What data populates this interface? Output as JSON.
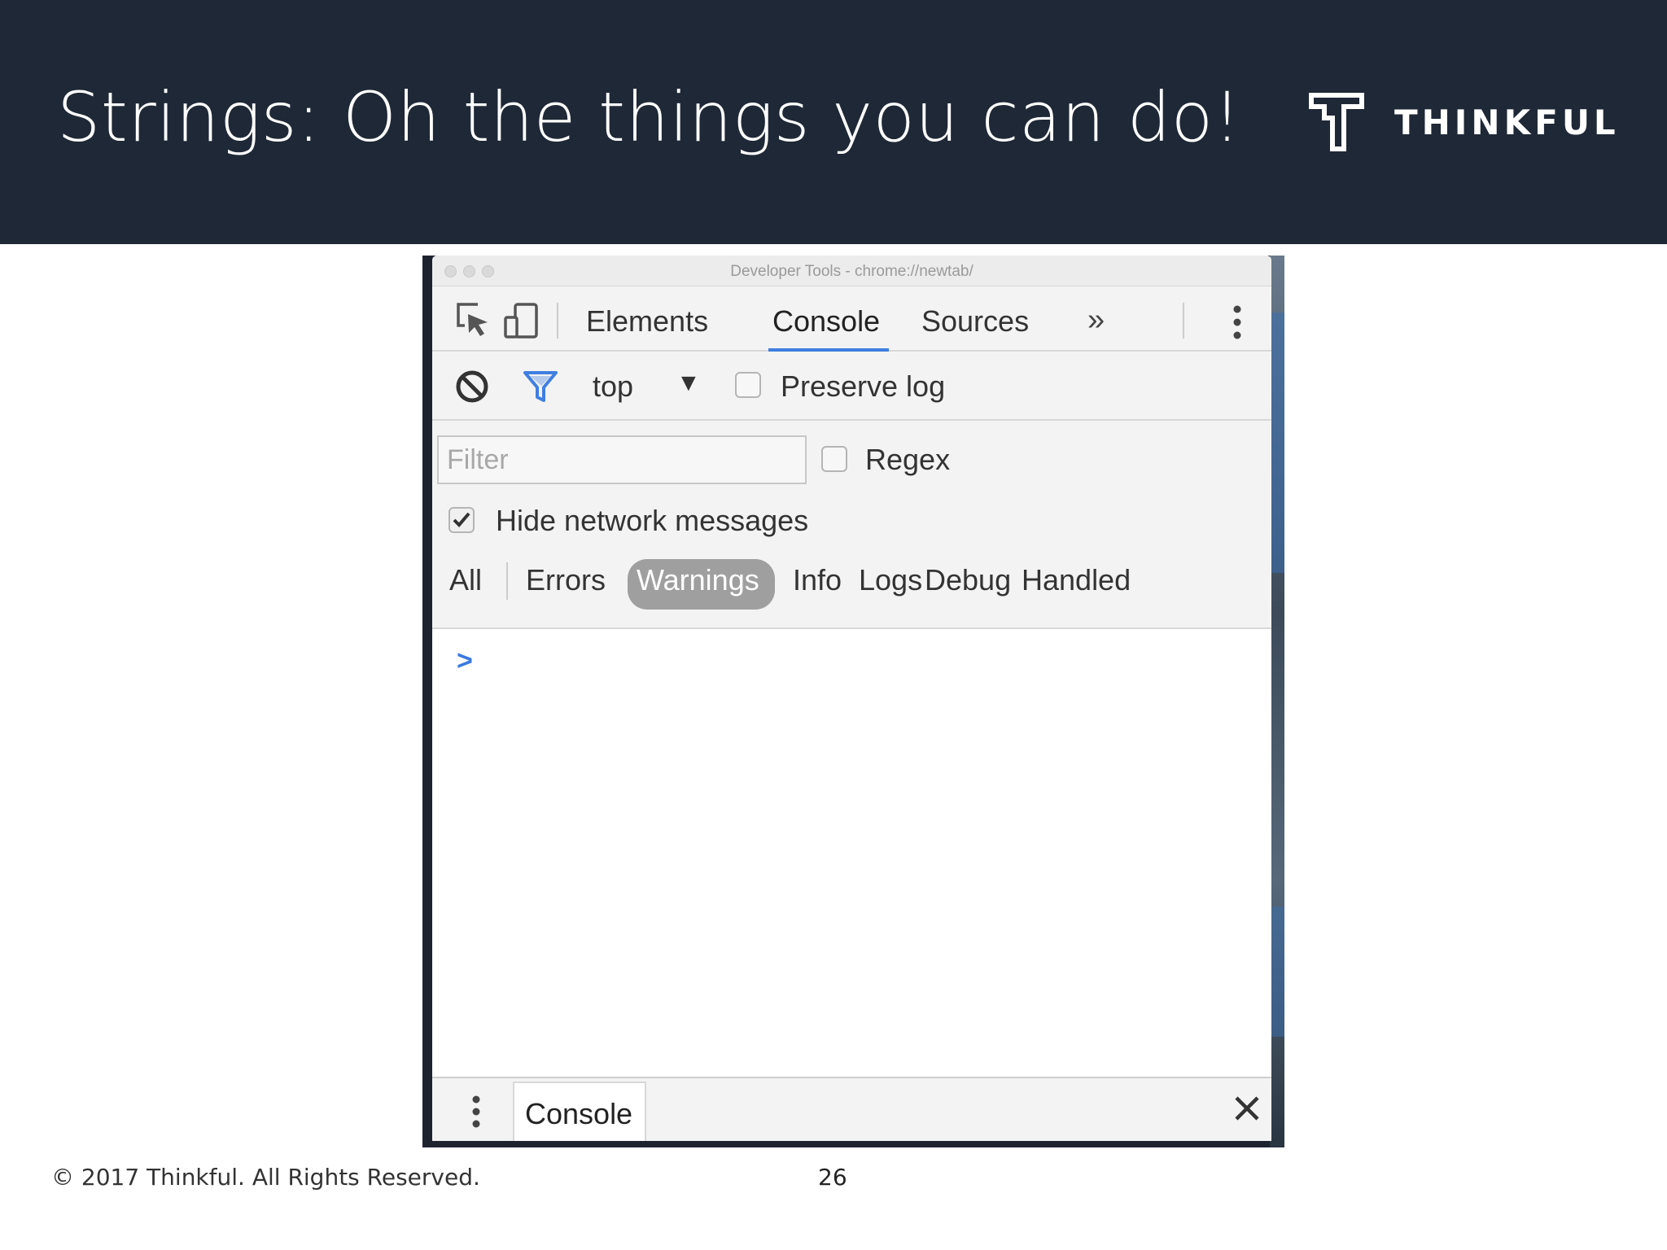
{
  "slide": {
    "title": "Strings: Oh the things you can do!",
    "brand_name": "THINKFUL",
    "copyright": "© 2017 Thinkful. All Rights Reserved.",
    "page_number": "26"
  },
  "devtools": {
    "window_title": "Developer Tools - chrome://newtab/",
    "toolbar": {
      "icons": [
        "inspect-element-icon",
        "device-toolbar-icon"
      ],
      "tabs": [
        {
          "label": "Elements"
        },
        {
          "label": "Console",
          "active": true
        },
        {
          "label": "Sources"
        }
      ],
      "more_tabs_label": "»",
      "menu_icon": "kebab-menu-icon"
    },
    "console_bar": {
      "context": "top",
      "context_arrow": "▼",
      "preserve_log_label": "Preserve log",
      "preserve_log_checked": false
    },
    "filter": {
      "placeholder": "Filter",
      "value": "",
      "regex_label": "Regex",
      "regex_checked": false,
      "hide_network_label": "Hide network messages",
      "hide_network_checked": true
    },
    "levels": [
      {
        "label": "All"
      },
      {
        "label": "Errors"
      },
      {
        "label": "Warnings",
        "active": true
      },
      {
        "label": "Info"
      },
      {
        "label": "Logs"
      },
      {
        "label": "Debug"
      },
      {
        "label": "Handled"
      }
    ],
    "console": {
      "prompt": ">"
    },
    "drawer": {
      "tab_label": "Console",
      "close_icon": "close-icon"
    }
  },
  "colors": {
    "header_bg": "#1f2836",
    "accent_blue": "#3f7fe0",
    "active_level_pill": "#9f9f9f"
  }
}
